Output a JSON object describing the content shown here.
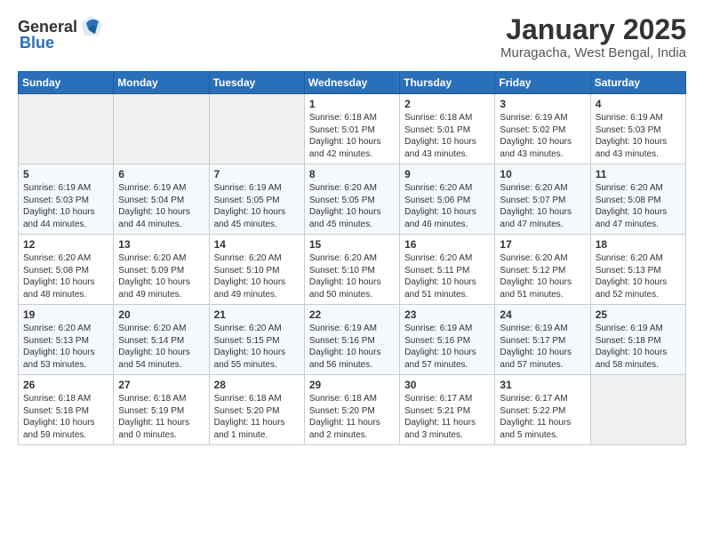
{
  "header": {
    "logo_general": "General",
    "logo_blue": "Blue",
    "month_title": "January 2025",
    "location": "Muragacha, West Bengal, India"
  },
  "days_of_week": [
    "Sunday",
    "Monday",
    "Tuesday",
    "Wednesday",
    "Thursday",
    "Friday",
    "Saturday"
  ],
  "weeks": [
    [
      {
        "day": "",
        "empty": true
      },
      {
        "day": "",
        "empty": true
      },
      {
        "day": "",
        "empty": true
      },
      {
        "day": "1",
        "sunrise": "6:18 AM",
        "sunset": "5:01 PM",
        "daylight": "10 hours and 42 minutes."
      },
      {
        "day": "2",
        "sunrise": "6:18 AM",
        "sunset": "5:01 PM",
        "daylight": "10 hours and 43 minutes."
      },
      {
        "day": "3",
        "sunrise": "6:19 AM",
        "sunset": "5:02 PM",
        "daylight": "10 hours and 43 minutes."
      },
      {
        "day": "4",
        "sunrise": "6:19 AM",
        "sunset": "5:03 PM",
        "daylight": "10 hours and 43 minutes."
      }
    ],
    [
      {
        "day": "5",
        "sunrise": "6:19 AM",
        "sunset": "5:03 PM",
        "daylight": "10 hours and 44 minutes."
      },
      {
        "day": "6",
        "sunrise": "6:19 AM",
        "sunset": "5:04 PM",
        "daylight": "10 hours and 44 minutes."
      },
      {
        "day": "7",
        "sunrise": "6:19 AM",
        "sunset": "5:05 PM",
        "daylight": "10 hours and 45 minutes."
      },
      {
        "day": "8",
        "sunrise": "6:20 AM",
        "sunset": "5:05 PM",
        "daylight": "10 hours and 45 minutes."
      },
      {
        "day": "9",
        "sunrise": "6:20 AM",
        "sunset": "5:06 PM",
        "daylight": "10 hours and 46 minutes."
      },
      {
        "day": "10",
        "sunrise": "6:20 AM",
        "sunset": "5:07 PM",
        "daylight": "10 hours and 47 minutes."
      },
      {
        "day": "11",
        "sunrise": "6:20 AM",
        "sunset": "5:08 PM",
        "daylight": "10 hours and 47 minutes."
      }
    ],
    [
      {
        "day": "12",
        "sunrise": "6:20 AM",
        "sunset": "5:08 PM",
        "daylight": "10 hours and 48 minutes."
      },
      {
        "day": "13",
        "sunrise": "6:20 AM",
        "sunset": "5:09 PM",
        "daylight": "10 hours and 49 minutes."
      },
      {
        "day": "14",
        "sunrise": "6:20 AM",
        "sunset": "5:10 PM",
        "daylight": "10 hours and 49 minutes."
      },
      {
        "day": "15",
        "sunrise": "6:20 AM",
        "sunset": "5:10 PM",
        "daylight": "10 hours and 50 minutes."
      },
      {
        "day": "16",
        "sunrise": "6:20 AM",
        "sunset": "5:11 PM",
        "daylight": "10 hours and 51 minutes."
      },
      {
        "day": "17",
        "sunrise": "6:20 AM",
        "sunset": "5:12 PM",
        "daylight": "10 hours and 51 minutes."
      },
      {
        "day": "18",
        "sunrise": "6:20 AM",
        "sunset": "5:13 PM",
        "daylight": "10 hours and 52 minutes."
      }
    ],
    [
      {
        "day": "19",
        "sunrise": "6:20 AM",
        "sunset": "5:13 PM",
        "daylight": "10 hours and 53 minutes."
      },
      {
        "day": "20",
        "sunrise": "6:20 AM",
        "sunset": "5:14 PM",
        "daylight": "10 hours and 54 minutes."
      },
      {
        "day": "21",
        "sunrise": "6:20 AM",
        "sunset": "5:15 PM",
        "daylight": "10 hours and 55 minutes."
      },
      {
        "day": "22",
        "sunrise": "6:19 AM",
        "sunset": "5:16 PM",
        "daylight": "10 hours and 56 minutes."
      },
      {
        "day": "23",
        "sunrise": "6:19 AM",
        "sunset": "5:16 PM",
        "daylight": "10 hours and 57 minutes."
      },
      {
        "day": "24",
        "sunrise": "6:19 AM",
        "sunset": "5:17 PM",
        "daylight": "10 hours and 57 minutes."
      },
      {
        "day": "25",
        "sunrise": "6:19 AM",
        "sunset": "5:18 PM",
        "daylight": "10 hours and 58 minutes."
      }
    ],
    [
      {
        "day": "26",
        "sunrise": "6:18 AM",
        "sunset": "5:18 PM",
        "daylight": "10 hours and 59 minutes."
      },
      {
        "day": "27",
        "sunrise": "6:18 AM",
        "sunset": "5:19 PM",
        "daylight": "11 hours and 0 minutes."
      },
      {
        "day": "28",
        "sunrise": "6:18 AM",
        "sunset": "5:20 PM",
        "daylight": "11 hours and 1 minute."
      },
      {
        "day": "29",
        "sunrise": "6:18 AM",
        "sunset": "5:20 PM",
        "daylight": "11 hours and 2 minutes."
      },
      {
        "day": "30",
        "sunrise": "6:17 AM",
        "sunset": "5:21 PM",
        "daylight": "11 hours and 3 minutes."
      },
      {
        "day": "31",
        "sunrise": "6:17 AM",
        "sunset": "5:22 PM",
        "daylight": "11 hours and 5 minutes."
      },
      {
        "day": "",
        "empty": true
      }
    ]
  ]
}
